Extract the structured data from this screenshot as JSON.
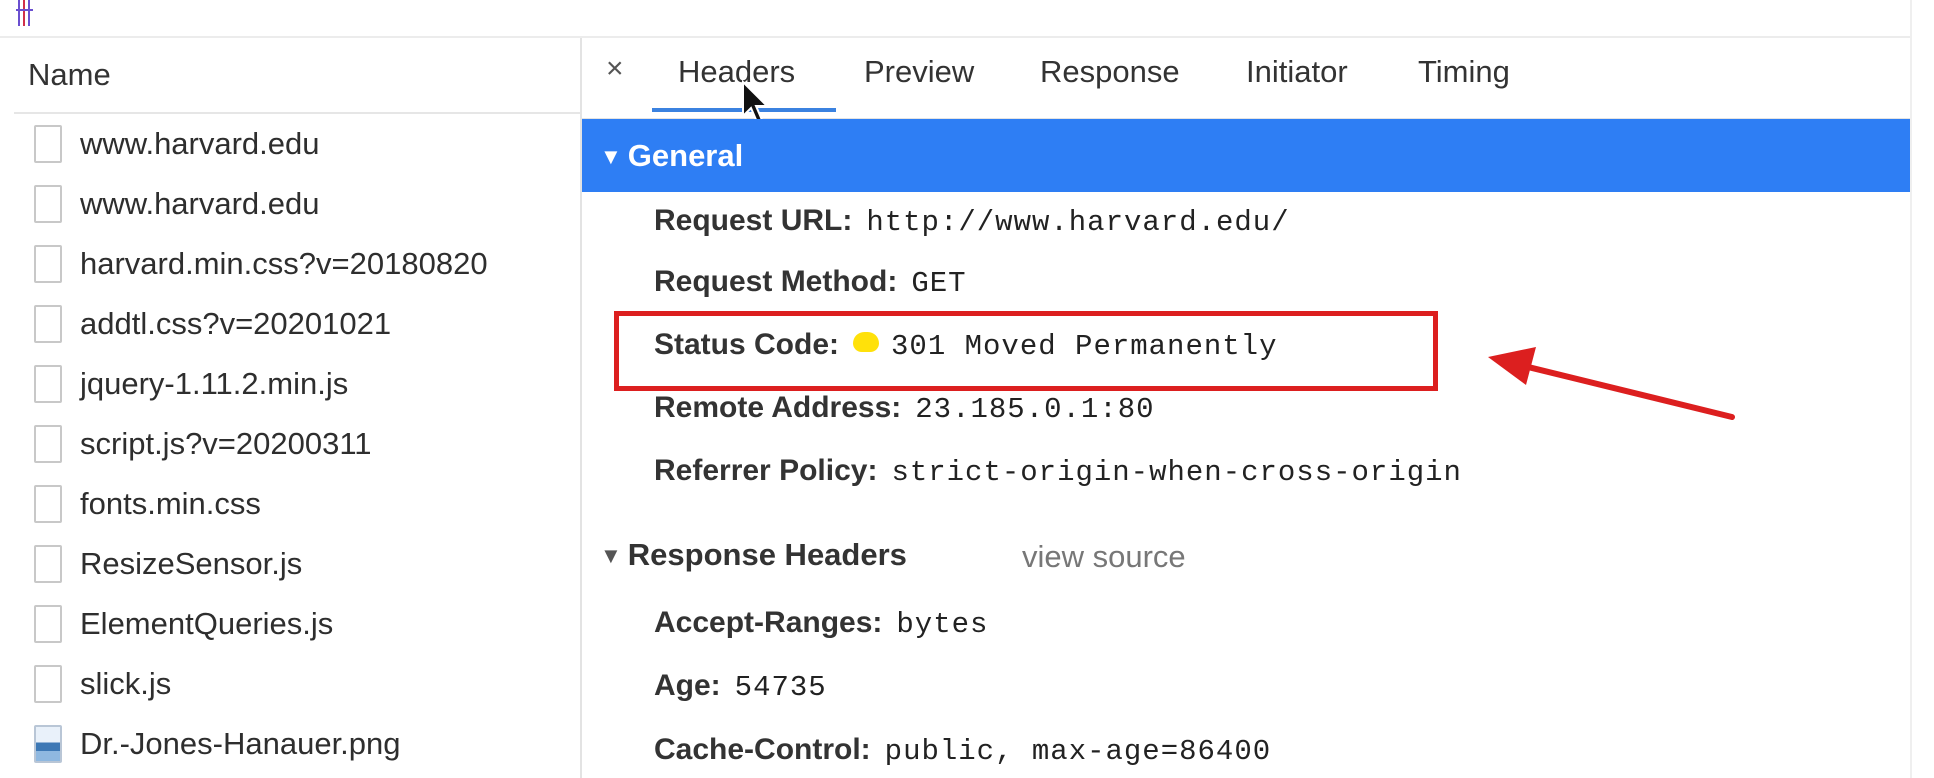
{
  "name_panel": {
    "header": "Name",
    "files": [
      {
        "name": "www.harvard.edu",
        "icon": "document-icon"
      },
      {
        "name": "www.harvard.edu",
        "icon": "document-icon"
      },
      {
        "name": "harvard.min.css?v=20180820",
        "icon": "document-icon"
      },
      {
        "name": "addtl.css?v=20201021",
        "icon": "document-icon"
      },
      {
        "name": "jquery-1.11.2.min.js",
        "icon": "document-icon"
      },
      {
        "name": "script.js?v=20200311",
        "icon": "document-icon"
      },
      {
        "name": "fonts.min.css",
        "icon": "document-icon"
      },
      {
        "name": "ResizeSensor.js",
        "icon": "document-icon"
      },
      {
        "name": "ElementQueries.js",
        "icon": "document-icon"
      },
      {
        "name": "slick.js",
        "icon": "document-icon"
      },
      {
        "name": "Dr.-Jones-Hanauer.png",
        "icon": "image-thumbnail-icon"
      }
    ]
  },
  "tabs": {
    "close": "×",
    "items": [
      "Headers",
      "Preview",
      "Response",
      "Initiator",
      "Timing"
    ],
    "active": "Headers"
  },
  "general": {
    "title": "General",
    "rows": [
      {
        "key": "Request URL:",
        "value": "http://www.harvard.edu/"
      },
      {
        "key": "Request Method:",
        "value": "GET"
      },
      {
        "key": "Status Code:",
        "value": "301 Moved Permanently"
      },
      {
        "key": "Remote Address:",
        "value": "23.185.0.1:80"
      },
      {
        "key": "Referrer Policy:",
        "value": "strict-origin-when-cross-origin"
      }
    ]
  },
  "response_headers": {
    "title": "Response Headers",
    "view_source": "view source",
    "rows": [
      {
        "key": "Accept-Ranges:",
        "value": "bytes"
      },
      {
        "key": "Age:",
        "value": "54735"
      },
      {
        "key": "Cache-Control:",
        "value": "public, max-age=86400"
      }
    ]
  },
  "colors": {
    "general_bar": "#2e7ef4",
    "tab_underline": "#3b82e0",
    "annotation": "#dc1f1f",
    "status_dot": "#ffe10a"
  }
}
